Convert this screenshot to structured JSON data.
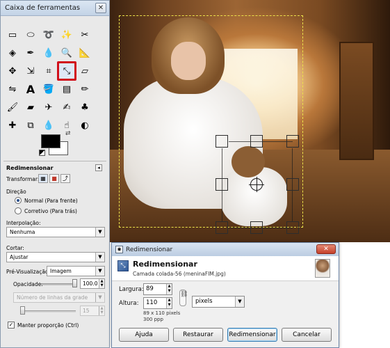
{
  "toolbox": {
    "title": "Caixa de ferramentas",
    "close_label": "✕"
  },
  "tool_options": {
    "title": "Redimensionar",
    "collapse": "◂",
    "transform_label": "Transformar:",
    "direction_label": "Direção",
    "direction_options": [
      "Normal (Para frente)",
      "Corretivo (Para trás)"
    ],
    "interpolation_label": "Interpolação:",
    "interpolation_value": "Nenhuma",
    "clip_label": "Cortar:",
    "clip_value": "Ajustar",
    "preview_label": "Pré-Visualização:",
    "preview_value": "Imagem",
    "opacity_label": "Opacidade:",
    "opacity_value": "100.0",
    "opacity_level": 1.0,
    "grid_lines_value": "Número de linhas da grade",
    "grid_lines_count": "15",
    "keep_proportion_label": "Manter proporção (Ctrl)",
    "keep_proportion_checked": true
  },
  "dialog": {
    "title": "Redimensionar",
    "close_label": "✕",
    "heading": "Redimensionar",
    "subheading": "Camada colada-56 (meninaFIM.jpg)",
    "width_label": "Largura:",
    "width_value": "89",
    "height_label": "Altura:",
    "height_value": "110",
    "unit_value": "pixels",
    "size_info": "89 x 110 pixels",
    "resolution_info": "300 ppp",
    "buttons": {
      "help": "Ajuda",
      "reset": "Restaurar",
      "resize": "Redimensionar",
      "cancel": "Cancelar"
    }
  },
  "colors": {
    "highlight": "#d10f1a",
    "layer_boundary": "#ece24a",
    "titlebar": "#c3d3e6"
  },
  "icons": [
    "rect-select-icon",
    "ellipse-select-icon",
    "free-select-icon",
    "fuzzy-select-icon",
    "scissors-select-icon",
    "color-select-icon",
    "paths-icon",
    "color-picker-icon",
    "zoom-icon",
    "measure-icon",
    "move-icon",
    "align-icon",
    "crop-icon",
    "scale-icon",
    "shear-icon",
    "flip-icon",
    "text-icon",
    "bucket-fill-icon",
    "blend-icon",
    "pencil-icon",
    "paintbrush-icon",
    "eraser-icon",
    "airbrush-icon",
    "ink-icon",
    "clone-icon",
    "heal-icon",
    "perspective-clone-icon",
    "blur-icon",
    "smudge-icon",
    "dodge-burn-icon"
  ]
}
